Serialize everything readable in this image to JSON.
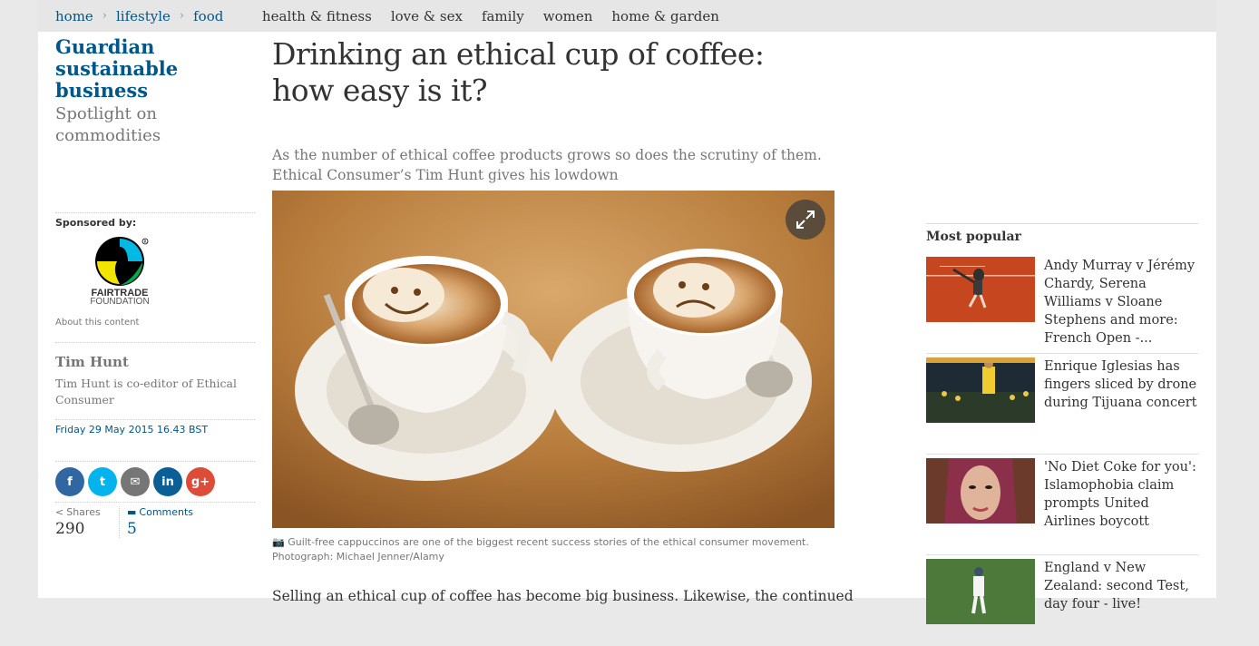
{
  "breadcrumb": [
    "home",
    "lifestyle",
    "food"
  ],
  "subnav": [
    "health & fitness",
    "love & sex",
    "family",
    "women",
    "home & garden"
  ],
  "series": {
    "title": "Guardian sustainable business",
    "subtitle": "Spotlight on commodities"
  },
  "sponsor": {
    "label": "Sponsored by:",
    "logo_text_1": "FAIRTRADE",
    "logo_text_2": "FOUNDATION",
    "about": "About this content"
  },
  "author": {
    "name": "Tim Hunt",
    "bio": "Tim Hunt is co-editor of Ethical Consumer"
  },
  "date": "Friday 29 May 2015 16.43 BST",
  "share": {
    "buttons": [
      {
        "icon": "facebook-icon",
        "glyph": "f",
        "color": "#3067a3"
      },
      {
        "icon": "twitter-icon",
        "glyph": "t",
        "color": "#03b3ee"
      },
      {
        "icon": "email-icon",
        "glyph": "✉",
        "color": "#767676"
      },
      {
        "icon": "linkedin-icon",
        "glyph": "in",
        "color": "#0b5f97"
      },
      {
        "icon": "googleplus-icon",
        "glyph": "g+",
        "color": "#dd4b39"
      }
    ],
    "shares_label": "Shares",
    "shares_count": "290",
    "comments_label": "Comments",
    "comments_count": "5"
  },
  "article": {
    "headline": "Drinking an ethical cup of coffee: how easy is it?",
    "standfirst": "As the number of ethical coffee products grows so does the scrutiny of them. Ethical Consumer’s Tim Hunt gives his lowdown",
    "caption": "Guilt-free cappuccinos are one of the biggest recent success stories of the ethical consumer movement.",
    "credit": "Photograph: Michael Jenner/Alamy",
    "body_start": "Selling an ethical cup of coffee has become big business. Likewise, the continued"
  },
  "most_popular": {
    "title": "Most popular",
    "items": [
      {
        "headline": "Andy Murray v Jérémy Chardy, Serena Williams v Sloane Stephens and more: French Open -..."
      },
      {
        "headline": "Enrique Iglesias has fingers sliced by drone during Tijuana concert"
      },
      {
        "headline": "'No Diet Coke for you': Islamophobia claim prompts United Airlines boycott"
      },
      {
        "headline": "England v New Zealand: second Test, day four - live!"
      }
    ]
  },
  "colors": {
    "brand": "#005689",
    "text": "#333333",
    "muted": "#767676"
  }
}
